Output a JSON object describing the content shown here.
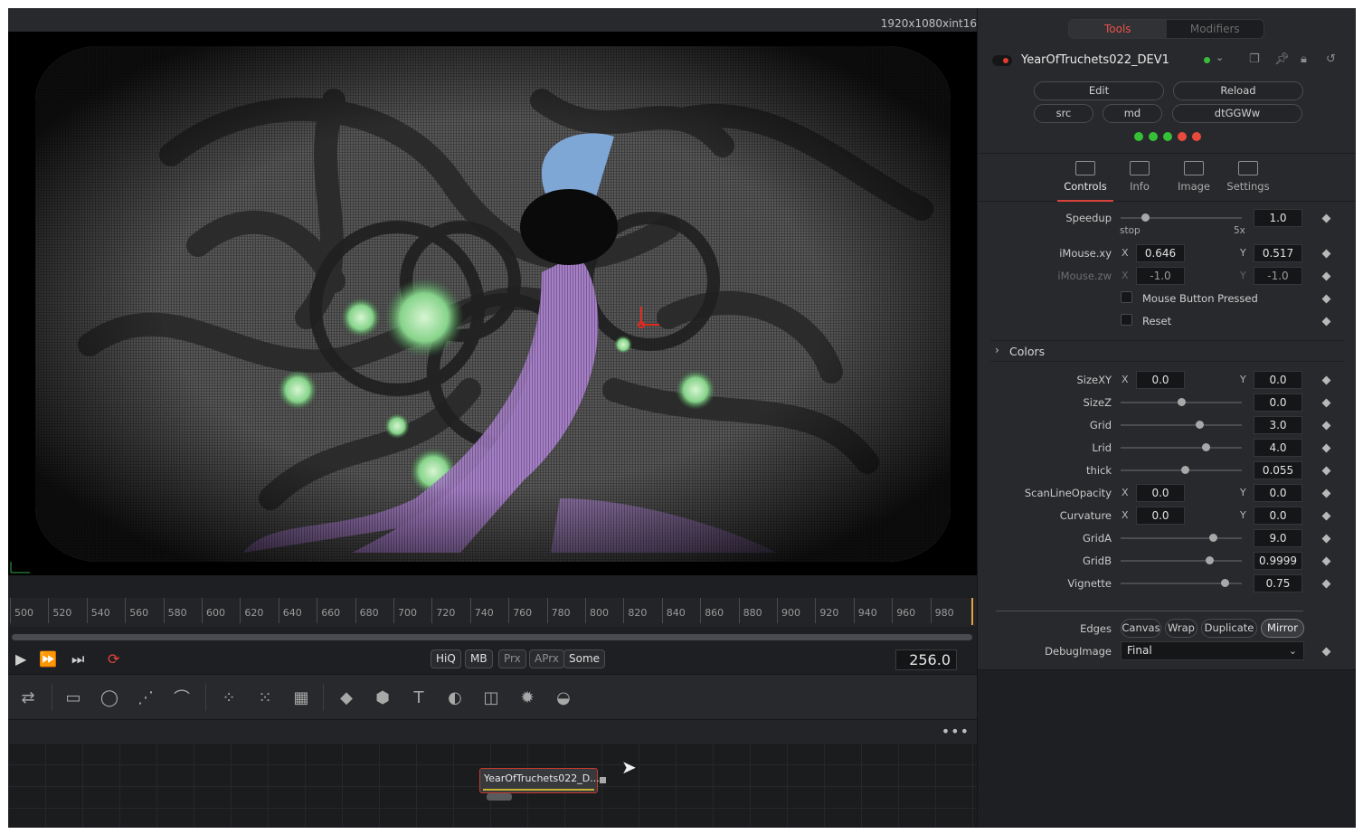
{
  "viewer": {
    "resolution": "1920x1080xint16"
  },
  "timeline": {
    "ticks": [
      "500",
      "520",
      "540",
      "560",
      "580",
      "600",
      "620",
      "640",
      "660",
      "680",
      "700",
      "720",
      "740",
      "760",
      "780",
      "800",
      "820",
      "840",
      "860",
      "880",
      "900",
      "920",
      "940",
      "960",
      "980"
    ]
  },
  "transport": {
    "hiq": "HiQ",
    "mb": "MB",
    "prx": "Prx",
    "aprx": "APrx",
    "some": "Some",
    "current_frame": "256.0"
  },
  "node_editor": {
    "node_label": "YearOfTruchets022_D...",
    "more": "•••"
  },
  "inspector": {
    "tabs": {
      "tools": "Tools",
      "modifiers": "Modifiers"
    },
    "tool_name": "YearOfTruchets022_DEV1",
    "buttons": {
      "edit": "Edit",
      "reload": "Reload",
      "src": "src",
      "md": "md",
      "dtggww": "dtGGWw"
    },
    "leds": [
      "#35c035",
      "#35c035",
      "#35c035",
      "#e84a3c",
      "#e84a3c"
    ],
    "subtabs": {
      "controls": "Controls",
      "info": "Info",
      "image": "Image",
      "settings": "Settings"
    },
    "speedup": {
      "label": "Speedup",
      "value": "1.0",
      "min_label": "stop",
      "max_label": "5x",
      "position": 0.2
    },
    "imouse_xy": {
      "label": "iMouse.xy",
      "x_axis": "X",
      "y_axis": "Y",
      "x": "0.646",
      "y": "0.517"
    },
    "imouse_zw": {
      "label": "iMouse.zw",
      "x_axis": "X",
      "y_axis": "Y",
      "x": "-1.0",
      "y": "-1.0"
    },
    "mouse_button_pressed": {
      "label": "Mouse Button Pressed",
      "checked": false
    },
    "reset": {
      "label": "Reset",
      "checked": false
    },
    "colors_group": "Colors",
    "sizexy": {
      "label": "SizeXY",
      "x_axis": "X",
      "y_axis": "Y",
      "x": "0.0",
      "y": "0.0"
    },
    "sizez": {
      "label": "SizeZ",
      "value": "0.0",
      "position": 0.5
    },
    "grid": {
      "label": "Grid",
      "value": "3.0",
      "position": 0.65
    },
    "lrid": {
      "label": "Lrid",
      "value": "4.0",
      "position": 0.7
    },
    "thick": {
      "label": "thick",
      "value": "0.055",
      "position": 0.53
    },
    "scanline_opacity": {
      "label": "ScanLineOpacity",
      "x_axis": "X",
      "y_axis": "Y",
      "x": "0.0",
      "y": "0.0"
    },
    "curvature": {
      "label": "Curvature",
      "x_axis": "X",
      "y_axis": "Y",
      "x": "0.0",
      "y": "0.0"
    },
    "grida": {
      "label": "GridA",
      "value": "9.0",
      "position": 0.76
    },
    "gridb": {
      "label": "GridB",
      "value": "0.9999",
      "position": 0.73
    },
    "vignette": {
      "label": "Vignette",
      "value": "0.75",
      "position": 0.86
    },
    "edges": {
      "label": "Edges",
      "options": [
        "Canvas",
        "Wrap",
        "Duplicate",
        "Mirror"
      ],
      "selected": "Mirror"
    },
    "debug_image": {
      "label": "DebugImage",
      "value": "Final"
    }
  },
  "colors": {
    "accent_red": "#e8524a",
    "playhead": "#e3a23b",
    "node_border": "#c43a2f"
  }
}
